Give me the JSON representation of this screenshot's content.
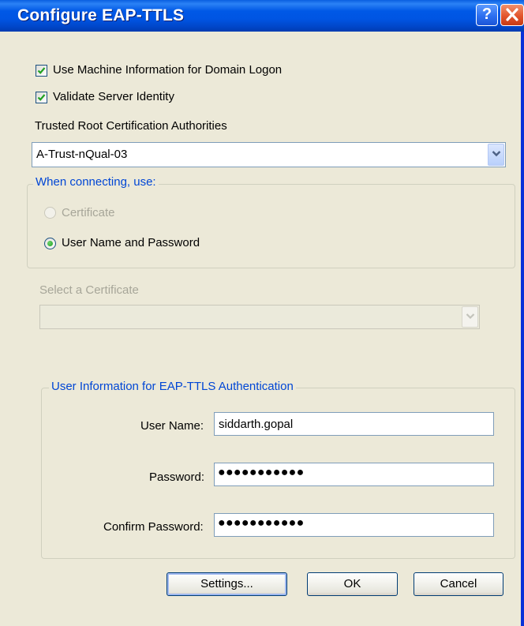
{
  "window": {
    "title": "Configure EAP-TTLS",
    "help_label": "?"
  },
  "options": {
    "machine_info_label": "Use Machine Information for Domain Logon",
    "machine_info_checked": true,
    "validate_label": "Validate Server Identity",
    "validate_checked": true
  },
  "trusted_root": {
    "label": "Trusted Root Certification Authorities",
    "selected": "A-Trust-nQual-03"
  },
  "connecting_group": {
    "title": "When connecting, use:",
    "certificate_label": "Certificate",
    "certificate_enabled": false,
    "username_password_label": "User Name and Password",
    "username_password_selected": true
  },
  "certificate_select": {
    "label": "Select a Certificate",
    "selected": "",
    "enabled": false
  },
  "user_info_group": {
    "title": "User Information for EAP-TTLS Authentication",
    "username_label": "User Name:",
    "username_value": "siddarth.gopal",
    "password_label": "Password:",
    "password_value": "●●●●●●●●●●●",
    "confirm_label": "Confirm Password:",
    "confirm_value": "●●●●●●●●●●●"
  },
  "buttons": {
    "settings": "Settings...",
    "ok": "OK",
    "cancel": "Cancel"
  }
}
